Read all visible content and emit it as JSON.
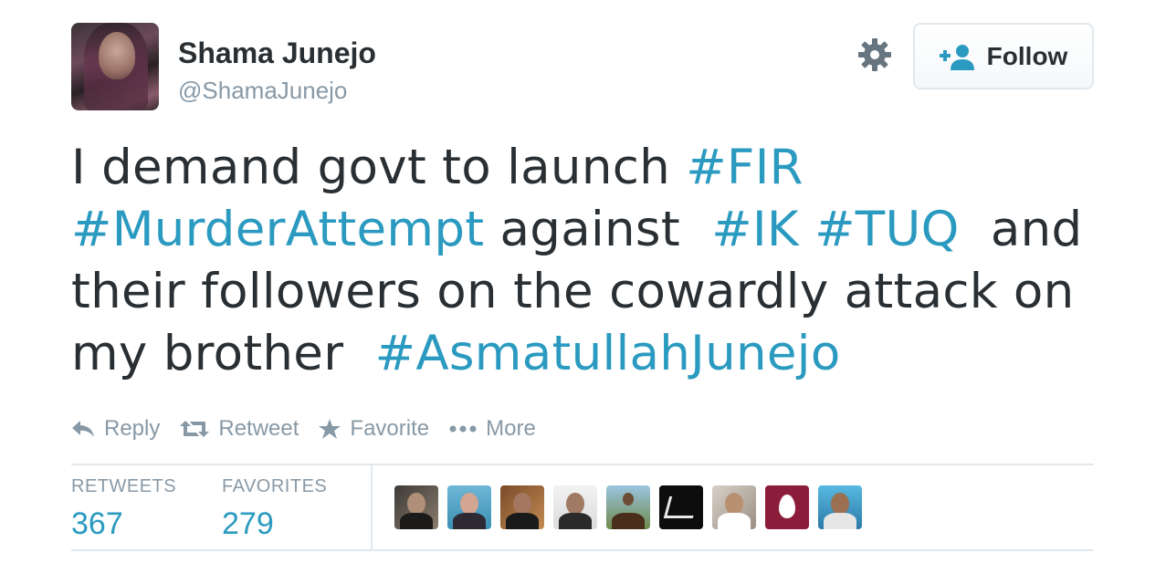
{
  "author": {
    "full_name": "Shama Junejo",
    "username": "@ShamaJunejo"
  },
  "header": {
    "follow_label": "Follow"
  },
  "tweet": {
    "line1_text": "I demand govt to launch ",
    "line1_tag": "#FIR",
    "line2_tag1": "#MurderAttempt",
    "line2_text1": " against  ",
    "line2_tag2": "#IK",
    "line2_space": " ",
    "line2_tag3": "#TUQ",
    "line2_text2": "  and",
    "line3_text": "their followers on the cowardly attack on",
    "line4_text": "my brother  ",
    "line4_tag": "#AsmatullahJunejo"
  },
  "actions": {
    "reply": "Reply",
    "retweet": "Retweet",
    "favorite": "Favorite",
    "more": "More"
  },
  "stats": {
    "retweets_label": "RETWEETS",
    "retweets_value": "367",
    "favorites_label": "FAVORITES",
    "favorites_value": "279"
  },
  "colors": {
    "link": "#2b9ac0",
    "muted": "#8899a6",
    "text": "#292f33",
    "border": "#e1e8ed"
  },
  "icons": [
    "gear-icon",
    "add-user-icon",
    "reply-icon",
    "retweet-icon",
    "star-icon",
    "more-dots-icon"
  ]
}
